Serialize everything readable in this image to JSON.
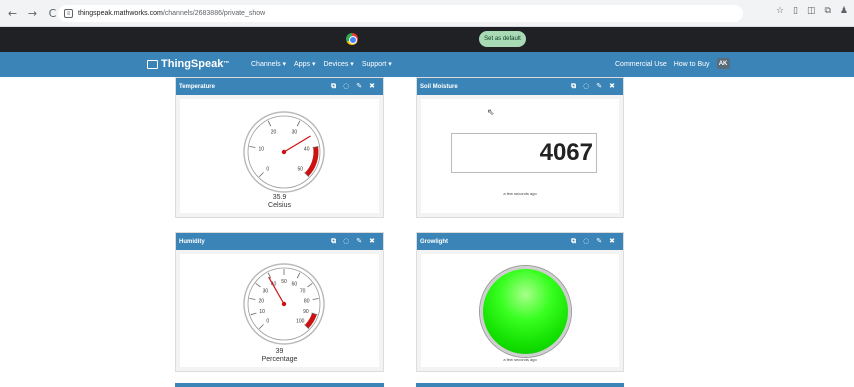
{
  "browser": {
    "back_icon": "←",
    "forward_icon": "→",
    "reload_icon": "C",
    "url_host": "thingspeak.mathworks.com",
    "url_path": "/channels/2683886/private_show",
    "right_icons": [
      "☆",
      "▯",
      "◫",
      "⧉",
      "♟"
    ]
  },
  "notification": {
    "set_default_label": "Set as default"
  },
  "navbar": {
    "logo": "ThingSpeak",
    "logo_tm": "™",
    "menu": [
      "Channels ▾",
      "Apps ▾",
      "Devices ▾",
      "Support ▾"
    ],
    "commercial_use": "Commercial Use",
    "how_to_buy": "How to Buy",
    "avatar_initials": "AK"
  },
  "widgets": {
    "tool_icons": [
      "⧉",
      "◌",
      "✎",
      "✖"
    ],
    "temperature": {
      "title": "Temperature",
      "value": "35.9",
      "unit": "Celsius",
      "min": 0,
      "max": 50,
      "ticks": [
        "0",
        "10",
        "20",
        "30",
        "40",
        "50"
      ],
      "needle_value": 35.9,
      "red_zone_start": 40
    },
    "soil_moisture": {
      "title": "Soil Moisture",
      "value": "4067",
      "timestamp": "a few seconds ago"
    },
    "humidity": {
      "title": "Humidity",
      "value": "39",
      "unit": "Percentage",
      "min": 0,
      "max": 100,
      "ticks": [
        "0",
        "10",
        "20",
        "30",
        "40",
        "50",
        "60",
        "70",
        "80",
        "90",
        "100"
      ],
      "needle_value": 39,
      "red_zone_start": 90
    },
    "growlight": {
      "title": "Growlight",
      "timestamp": "a few seconds ago",
      "lamp_color": "#22ee11"
    }
  },
  "colors": {
    "navbar": "#3b84b7",
    "gauge_red": "#cc1111"
  }
}
